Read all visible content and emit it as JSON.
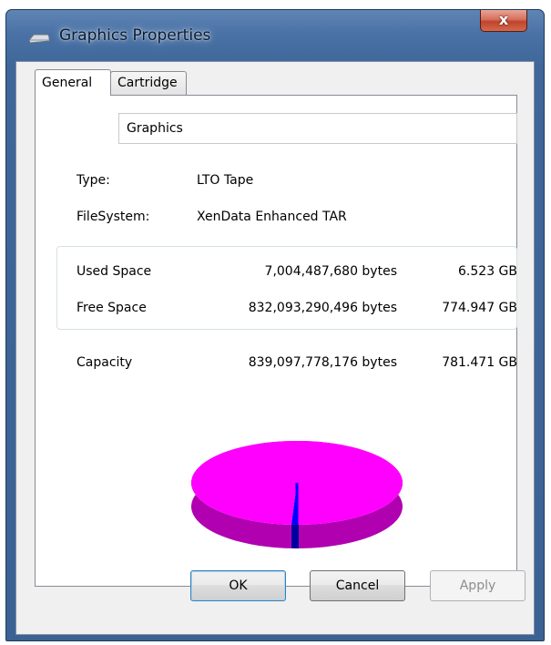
{
  "window": {
    "title": "Graphics Properties",
    "close_glyph": "x",
    "icon": "drive-icon"
  },
  "tabs": [
    {
      "label": "General",
      "selected": true
    },
    {
      "label": "Cartridge",
      "selected": false
    }
  ],
  "general": {
    "name": "Graphics",
    "type_label": "Type:",
    "type_value": "LTO Tape",
    "filesystem_label": "FileSystem:",
    "filesystem_value": "XenData Enhanced TAR",
    "used": {
      "label": "Used Space",
      "bytes": "7,004,487,680 bytes",
      "size": "6.523 GB"
    },
    "free": {
      "label": "Free Space",
      "bytes": "832,093,290,496 bytes",
      "size": "774.947 GB"
    },
    "capacity": {
      "label": "Capacity",
      "bytes": "839,097,778,176 bytes",
      "size": "781.471 GB"
    }
  },
  "chart_data": {
    "type": "pie",
    "slices": [
      {
        "label": "Used Space",
        "value": 6.523,
        "color": "#0000ff"
      },
      {
        "label": "Free Space",
        "value": 774.947,
        "color": "#ff00ff"
      }
    ]
  },
  "buttons": {
    "ok": "OK",
    "cancel": "Cancel",
    "apply": "Apply",
    "apply_enabled": false
  }
}
